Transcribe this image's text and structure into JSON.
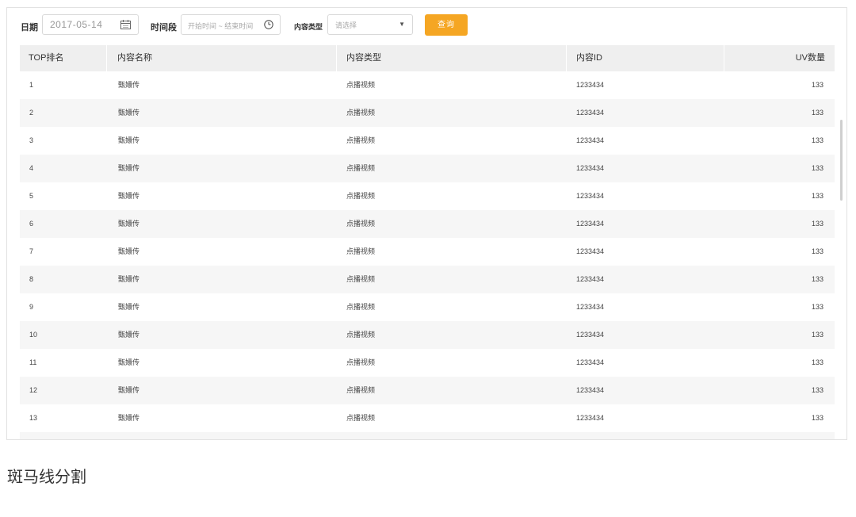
{
  "filters": {
    "date_label": "日期",
    "date_value": "2017-05-14",
    "time_label": "时间段",
    "time_placeholder": "开始时间 ~ 结束时间",
    "type_label": "内容类型",
    "type_placeholder": "请选择",
    "query_button": "查询"
  },
  "table": {
    "columns": [
      "TOP排名",
      "内容名称",
      "内容类型",
      "内容ID",
      "UV数量"
    ],
    "rows": [
      [
        "1",
        "甄嬛传",
        "点播视频",
        "1233434",
        "133"
      ],
      [
        "2",
        "甄嬛传",
        "点播视频",
        "1233434",
        "133"
      ],
      [
        "3",
        "甄嬛传",
        "点播视频",
        "1233434",
        "133"
      ],
      [
        "4",
        "甄嬛传",
        "点播视频",
        "1233434",
        "133"
      ],
      [
        "5",
        "甄嬛传",
        "点播视频",
        "1233434",
        "133"
      ],
      [
        "6",
        "甄嬛传",
        "点播视频",
        "1233434",
        "133"
      ],
      [
        "7",
        "甄嬛传",
        "点播视频",
        "1233434",
        "133"
      ],
      [
        "8",
        "甄嬛传",
        "点播视频",
        "1233434",
        "133"
      ],
      [
        "9",
        "甄嬛传",
        "点播视频",
        "1233434",
        "133"
      ],
      [
        "10",
        "甄嬛传",
        "点播视频",
        "1233434",
        "133"
      ],
      [
        "11",
        "甄嬛传",
        "点播视频",
        "1233434",
        "133"
      ],
      [
        "12",
        "甄嬛传",
        "点播视频",
        "1233434",
        "133"
      ],
      [
        "13",
        "甄嬛传",
        "点播视频",
        "1233434",
        "133"
      ]
    ]
  },
  "caption": "斑马线分割",
  "colors": {
    "accent": "#f5a623",
    "header_bg": "#efefef",
    "zebra_bg": "#f6f6f6"
  },
  "icons": {
    "date": "calendar-icon",
    "time": "clock-icon",
    "select": "caret-down-icon"
  }
}
